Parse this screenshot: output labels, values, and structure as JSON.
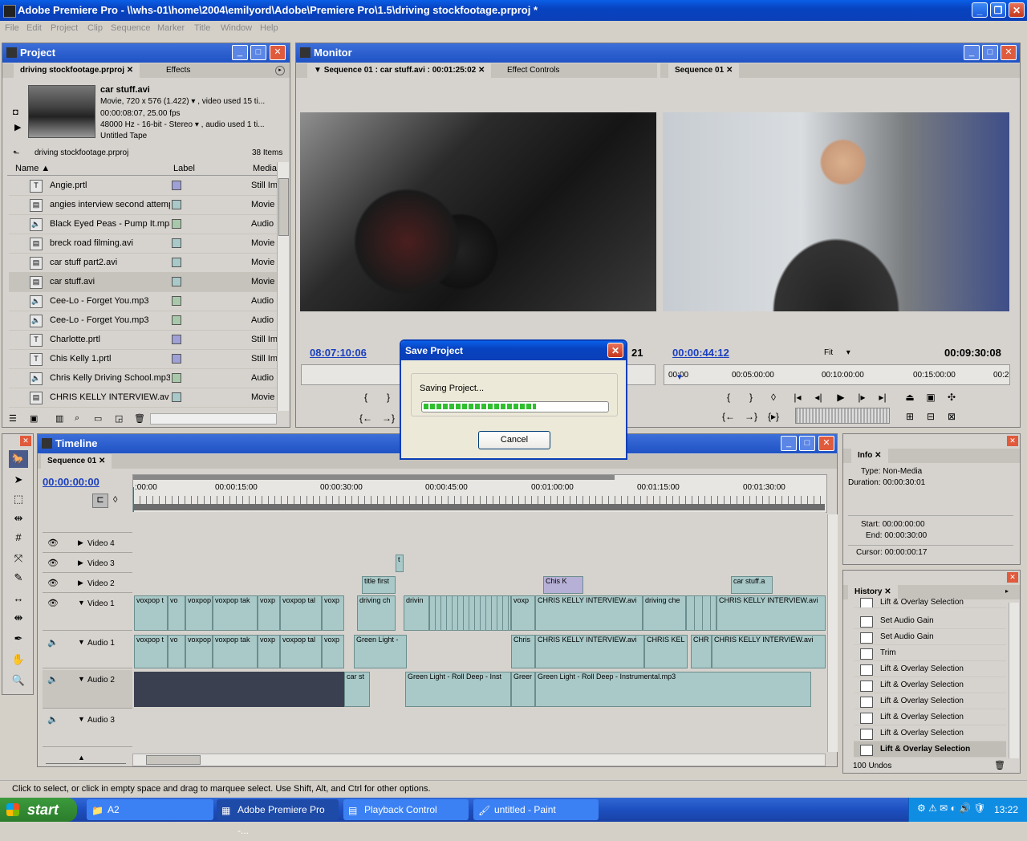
{
  "window": {
    "title": "Adobe Premiere Pro - \\\\whs-01\\home\\2004\\emilyord\\Adobe\\Premiere Pro\\1.5\\driving stockfootage.prproj *"
  },
  "menu": [
    "File",
    "Edit",
    "Project",
    "Clip",
    "Sequence",
    "Marker",
    "Title",
    "Window",
    "Help"
  ],
  "project": {
    "title": "Project",
    "tabs": [
      "driving stockfootage.prproj",
      "Effects"
    ],
    "clip_name": "car stuff.avi",
    "clip_line1": "Movie, 720 x 576 (1.422)",
    "clip_line1b": ", video used 15 ti...",
    "clip_line2": "00:00:08:07, 25.00 fps",
    "clip_line3": "48000 Hz - 16-bit - Stereo",
    "clip_line3b": ", audio used 1 ti...",
    "clip_line4": "Untitled Tape",
    "path": "driving stockfootage.prproj",
    "count": "38 Items",
    "columns": [
      "Name",
      "Label",
      "Media"
    ],
    "items": [
      {
        "name": "Angie.prtl",
        "type": "Still Im",
        "color": "#9fa0d6",
        "icon": "title-icon"
      },
      {
        "name": "angies interview second attemp",
        "type": "Movie",
        "color": "#a9c8c8",
        "icon": "movie-icon"
      },
      {
        "name": "Black Eyed Peas - Pump It.mp3",
        "type": "Audio",
        "color": "#a9c8a9",
        "icon": "speaker-icon"
      },
      {
        "name": "breck road filming.avi",
        "type": "Movie",
        "color": "#a9c8c8",
        "icon": "movie-icon"
      },
      {
        "name": "car stuff part2.avi",
        "type": "Movie",
        "color": "#a9c8c8",
        "icon": "movie-icon"
      },
      {
        "name": "car stuff.avi",
        "type": "Movie",
        "color": "#a9c8c8",
        "icon": "movie-icon"
      },
      {
        "name": "Cee-Lo - Forget You.mp3",
        "type": "Audio",
        "color": "#a9c8a9",
        "icon": "speaker-icon"
      },
      {
        "name": "Cee-Lo - Forget You.mp3",
        "type": "Audio",
        "color": "#a9c8a9",
        "icon": "speaker-icon"
      },
      {
        "name": "Charlotte.prtl",
        "type": "Still Im",
        "color": "#9fa0d6",
        "icon": "title-icon"
      },
      {
        "name": "Chis Kelly 1.prtl",
        "type": "Still Im",
        "color": "#9fa0d6",
        "icon": "title-icon"
      },
      {
        "name": "Chris Kelly Driving School.mp3",
        "type": "Audio",
        "color": "#a9c8a9",
        "icon": "speaker-icon"
      },
      {
        "name": "CHRIS KELLY INTERVIEW.av",
        "type": "Movie",
        "color": "#a9c8c8",
        "icon": "movie-icon"
      }
    ]
  },
  "monitor": {
    "title": "Monitor",
    "source_tab": "Sequence 01 : car stuff.avi : 00:01:25:02",
    "effect_tab": "Effect Controls",
    "program_tab": "Sequence 01",
    "source_tc": "08:07:10:06",
    "source_dur": "21",
    "program_tc": "00:00:44:12",
    "fit": "Fit",
    "program_dur": "00:09:30:08",
    "ruler": [
      "00:00",
      "00:05:00:00",
      "00:10:00:00",
      "00:15:00:00",
      "00:2"
    ]
  },
  "dialog": {
    "title": "Save Project",
    "message": "Saving Project...",
    "progress": 0.62,
    "cancel": "Cancel"
  },
  "timeline": {
    "title": "Timeline",
    "tab": "Sequence 01",
    "timecode": "00:00:00:00",
    "ruler": [
      ":00:00",
      "00:00:15:00",
      "00:00:30:00",
      "00:00:45:00",
      "00:01:00:00",
      "00:01:15:00",
      "00:01:30:00"
    ],
    "tracks": {
      "v4": "Video 4",
      "v3": "Video 3",
      "v2": "Video 2",
      "v1": "Video 1",
      "a1": "Audio 1",
      "a2": "Audio 2",
      "a3": "Audio 3"
    },
    "clips": {
      "v3_t": "t",
      "v2_title": "title first",
      "v2_chis": "Chis K",
      "v2_car": "car stuff.a",
      "v1_a": "voxpop t",
      "v1_b": "vo",
      "v1_c": "voxpop",
      "v1_d": "voxpop tak",
      "v1_e": "voxp",
      "v1_f": "voxpop tal",
      "v1_g": "voxp",
      "v1_h": "driving ch",
      "v1_i": "drivin",
      "v1_j": "voxp",
      "v1_k": "CHRIS KELLY INTERVIEW.avi",
      "v1_l": "driving che",
      "v1_m": "CHRIS KELLY INTERVIEW.avi",
      "a1_a": "voxpop t",
      "a1_b": "vo",
      "a1_c": "voxpop",
      "a1_d": "voxpop tak",
      "a1_e": "voxp",
      "a1_f": "voxpop tal",
      "a1_g": "voxp",
      "a1_h": "Green Light -",
      "a1_i": "Chris",
      "a1_j": "CHRIS KELLY INTERVIEW.avi",
      "a1_k": "CHRIS KEL",
      "a1_l": "CHR",
      "a1_m": "CHRIS KELLY INTERVIEW.avi",
      "a2_a": "car st",
      "a2_b": "Green Light - Roll Deep - Inst",
      "a2_c": "Greer",
      "a2_d": "Green Light - Roll Deep - Instrumental.mp3"
    }
  },
  "info": {
    "title": "Info",
    "type_label": "Type:",
    "type": "Non-Media",
    "duration_label": "Duration:",
    "duration": "00:00:30:01",
    "start_label": "Start:",
    "start": "00:00:00:00",
    "end_label": "End:",
    "end": "00:00:30:00",
    "cursor_label": "Cursor:",
    "cursor": "00:00:00:17"
  },
  "history": {
    "title": "History",
    "items": [
      "Lift & Overlay Selection",
      "Set Audio Gain",
      "Set Audio Gain",
      "Trim",
      "Lift & Overlay Selection",
      "Lift & Overlay Selection",
      "Lift & Overlay Selection",
      "Lift & Overlay Selection",
      "Lift & Overlay Selection",
      "Lift & Overlay Selection"
    ],
    "undos": "100 Undos"
  },
  "status": "Click to select, or click in empty space and drag to marquee select. Use Shift, Alt, and Ctrl for other options.",
  "taskbar": {
    "start": "start",
    "items": [
      "A2",
      "Adobe Premiere Pro -...",
      "Playback Control",
      "untitled - Paint"
    ],
    "clock": "13:22"
  }
}
